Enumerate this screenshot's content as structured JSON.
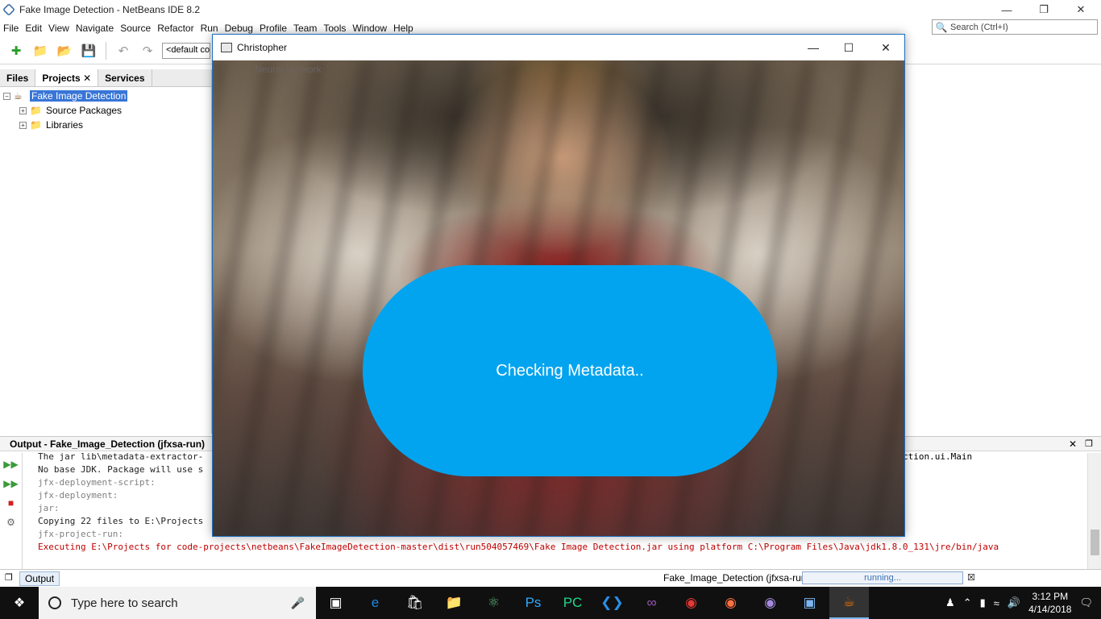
{
  "netbeans": {
    "window_title": "Fake Image Detection - NetBeans IDE 8.2",
    "menu": [
      "File",
      "Edit",
      "View",
      "Navigate",
      "Source",
      "Refactor",
      "Run",
      "Debug",
      "Profile",
      "Team",
      "Tools",
      "Window",
      "Help"
    ],
    "search_placeholder": "Search (Ctrl+I)",
    "config_select": "<default config>",
    "left_tabs": [
      "Files",
      "Projects",
      "Services"
    ],
    "tree": {
      "root": "Fake Image Detection",
      "children": [
        "Source Packages",
        "Libraries"
      ]
    },
    "output": {
      "title": "Output - Fake_Image_Detection (jfxsa-run)",
      "lines": [
        {
          "text": "The jar lib\\metadata-extractor-",
          "tail": "ction.ui.Main",
          "color": "#222222"
        },
        {
          "text": "No base JDK. Package will use s",
          "tail": "",
          "color": "#222222"
        },
        {
          "text": "jfx-deployment-script:",
          "tail": "",
          "color": "#808080"
        },
        {
          "text": "jfx-deployment:",
          "tail": "",
          "color": "#808080"
        },
        {
          "text": "jar:",
          "tail": "",
          "color": "#808080"
        },
        {
          "text": "Copying 22 files to E:\\Projects",
          "tail": "",
          "color": "#222222"
        },
        {
          "text": "jfx-project-run:",
          "tail": "",
          "color": "#808080"
        },
        {
          "text": "Executing E:\\Projects for code-projects\\netbeans\\FakeImageDetection-master\\dist\\run504057469\\Fake Image Detection.jar using platform C:\\Program Files\\Java\\jdk1.8.0_131\\jre/bin/java",
          "tail": "",
          "color": "#c00000"
        }
      ]
    },
    "status": {
      "output_tab": "Output",
      "task": "Fake_Image_Detection (jfxsa-run)",
      "progress_text": "running..."
    }
  },
  "fx": {
    "window_title": "Christopher",
    "caption": "Neural Network",
    "status_button": "Checking Metadata.."
  },
  "taskbar": {
    "search_placeholder": "Type here to search",
    "time": "3:12 PM",
    "date": "4/14/2018"
  }
}
